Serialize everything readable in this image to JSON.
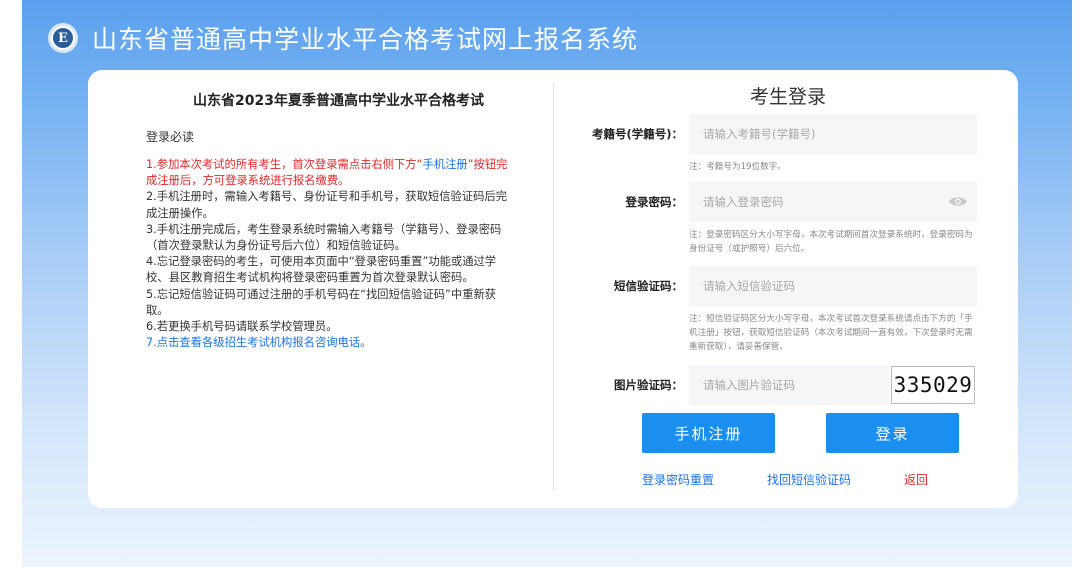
{
  "header": {
    "logo_letter": "E",
    "site_title": "山东省普通高中学业水平合格考试网上报名系统"
  },
  "left_panel": {
    "exam_title": "山东省2023年夏季普通高中学业水平合格考试",
    "notice_heading": "登录必读",
    "notice_1_a": "1.参加本次考试的所有考生，首次登录需点击右侧下方“",
    "notice_1_link": "手机注册",
    "notice_1_b": "”按钮完成注册后，方可登录系统进行报名缴费。",
    "notice_2": "2.手机注册时，需输入考籍号、身份证号和手机号，获取短信验证码后完成注册操作。",
    "notice_3": "3.手机注册完成后，考生登录系统时需输入考籍号（学籍号）、登录密码（首次登录默认为身份证号后六位）和短信验证码。",
    "notice_4": "4.忘记登录密码的考生，可使用本页面中“登录密码重置”功能或通过学校、县区教育招生考试机构将登录密码重置为首次登录默认密码。",
    "notice_5": "5.忘记短信验证码可通过注册的手机号码在“找回短信验证码”中重新获取。",
    "notice_6": "6.若更换手机号码请联系学校管理员。",
    "notice_7_prefix": "7.",
    "notice_7_link": "点击查看各级招生考试机构报名咨询电话。"
  },
  "login": {
    "title": "考生登录",
    "exam_id_label": "考籍号(学籍号)：",
    "exam_id_placeholder": "请输入考籍号(学籍号)",
    "exam_id_hint": "注：考籍号为19位数字。",
    "password_label": "登录密码：",
    "password_placeholder": "请输入登录密码",
    "password_hint": "注：登录密码区分大小写字母，本次考试期间首次登录系统时，登录密码为身份证号（或护照号）后六位。",
    "sms_label": "短信验证码：",
    "sms_placeholder": "请输入短信验证码",
    "sms_hint": "注：短信验证码区分大小写字母，本次考试首次登录系统请点击下方的「手机注册」按钮，获取短信验证码（本次考试期间一直有效，下次登录时无需重新获取），请妥善保管。",
    "captcha_label": "图片验证码：",
    "captcha_placeholder": "请输入图片验证码",
    "captcha_text": "335029",
    "register_button": "手机注册",
    "login_button": "登录",
    "reset_password_link": "登录密码重置",
    "recover_sms_link": "找回短信验证码",
    "back_link": "返回"
  },
  "colors": {
    "primary_button": "#1a8ff0",
    "link": "#1a73e8",
    "alert_red": "#e0292b",
    "header_blue": "#5aa0ee"
  }
}
